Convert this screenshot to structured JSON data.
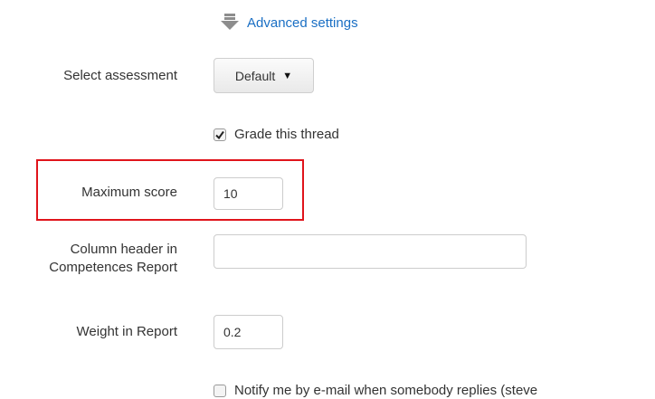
{
  "advanced": {
    "label": "Advanced settings",
    "icon": "download-arrow-icon"
  },
  "assessment": {
    "label": "Select assessment",
    "selected": "Default"
  },
  "grade_thread": {
    "label": "Grade this thread",
    "checked": true
  },
  "max_score": {
    "label": "Maximum score",
    "value": "10"
  },
  "column_header": {
    "label_line1": "Column header in",
    "label_line2": "Competences Report",
    "value": ""
  },
  "weight": {
    "label": "Weight in Report",
    "value": "0.2"
  },
  "notify": {
    "label": "Notify me by e-mail when somebody replies (steve",
    "checked": false
  },
  "colors": {
    "link": "#1a6fc4",
    "highlight": "#e0141b",
    "text": "#333333"
  }
}
